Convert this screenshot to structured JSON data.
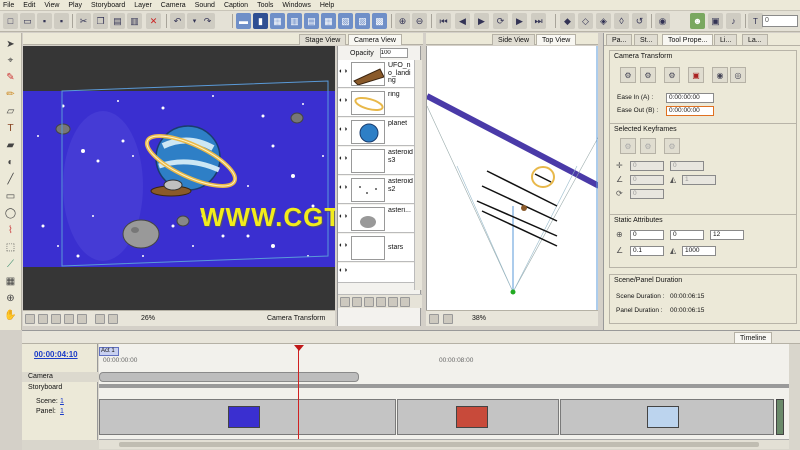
{
  "menu": [
    "File",
    "Edit",
    "View",
    "Play",
    "Storyboard",
    "Layer",
    "Camera",
    "Sound",
    "Caption",
    "Tools",
    "Windows",
    "Help"
  ],
  "toolbar": {
    "field_t": "0",
    "t_label": "T"
  },
  "views": {
    "stage_tab": "Stage View",
    "camera_tab": "Camera View",
    "side_tab": "Side View",
    "top_tab": "Top View",
    "stage_zoom": "26%",
    "stage_status": "Camera Transform",
    "side_zoom": "38%"
  },
  "camera_view": {
    "opacity_label": "Opacity",
    "opacity_value": "100",
    "layers": [
      {
        "name": "UFO_no_landing"
      },
      {
        "name": "ring"
      },
      {
        "name": "planet"
      },
      {
        "name": "asteroids3"
      },
      {
        "name": "asteroids2"
      },
      {
        "name": "asteri..."
      },
      {
        "name": "stars"
      }
    ]
  },
  "right_tabs": [
    "Pa...",
    "St...",
    "Tool Prope...",
    "Li...",
    "La..."
  ],
  "camera_transform": {
    "title": "Camera Transform",
    "ease_in_label": "Ease In (A) :",
    "ease_in_value": "0:00:00:00",
    "ease_out_label": "Ease Out (B) :",
    "ease_out_value": "0:00:00:00"
  },
  "selected_keyframes": {
    "title": "Selected Keyframes",
    "f1": "0",
    "f2": "0",
    "f3": "0",
    "f4": "1",
    "f5": "0"
  },
  "static_attributes": {
    "title": "Static Attributes",
    "x": "0",
    "y": "0",
    "z": "12",
    "angle": "0.1",
    "fov": "1000"
  },
  "scene_panel": {
    "title": "Scene/Panel Duration",
    "scene_label": "Scene Duration :",
    "scene_value": "00:00:06:15",
    "panel_label": "Panel Duration :",
    "panel_value": "00:00:06:15"
  },
  "timeline": {
    "tab": "Timeline",
    "timecode": "00:00:04:10",
    "act": "Act 1",
    "t0": "00:00:00:00",
    "t8": "00:00:08:00",
    "track_camera": "Camera",
    "track_storyboard": "Storyboard",
    "scene_label": "Scene:",
    "scene_num": "1",
    "panel_label": "Panel:",
    "panel_num": "1"
  },
  "watermark": "WWW.CGTSJ.COM",
  "colors": {
    "stage_bg": "#3a2fd0",
    "timeline_red": "#d02020",
    "accent": "#4a3aa8"
  }
}
